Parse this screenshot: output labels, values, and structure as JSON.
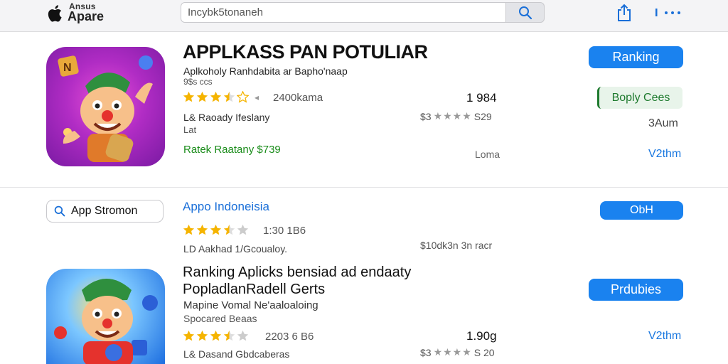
{
  "brand": {
    "top_label": "Ansus",
    "main_label": "Apare"
  },
  "search": {
    "value": "Incybk5tonaneh"
  },
  "colors": {
    "accent": "#1a82ef",
    "star": "#f5b400",
    "green": "#1a8c1a"
  },
  "featured": {
    "title": "APPLKASS PAN POTULIAR",
    "subtitle": "Aplkoholy Ranhdabita ar Bapho'naap",
    "meta_small": "9$s ccs",
    "rating": 3.5,
    "rating_count": "2400kama",
    "meta_a": "L& Raoady Ifeslany",
    "meta_b": "Lat",
    "promo": "Ratek Raatany  $739",
    "number": "1 984",
    "price_left": "$3",
    "price_right": "S29",
    "note": "Loma",
    "primary_button": "Ranking",
    "reply_button": "Boply Cees",
    "side_top": "3Aum",
    "side_bottom": "V2thm"
  },
  "store_pill": {
    "label": "App Stromon",
    "icon": "search-icon"
  },
  "second": {
    "link": "Appo Indoneisia",
    "button": "ObH",
    "rating": 3.5,
    "rating_count": "1:30 1B6",
    "meta": "LD Aakhad  1/Gcoualoy.",
    "price": "$10dk3n 3n racr"
  },
  "third": {
    "title_line1": "Ranking Aplicks bensiad ad endaaty",
    "title_line2": "PopladlanRadell Gerts",
    "subtitle": "Mapine Vomal Ne'aaloaloing",
    "meta_small": "Spocared Beaas",
    "rating": 3.5,
    "rating_count": "2203 6 B6",
    "meta": "L& Dasand  Gbdcaberas",
    "number": "1.90g",
    "price_left": "$3",
    "price_right": "S 20",
    "button": "Prdubies",
    "side": "V2thm"
  }
}
